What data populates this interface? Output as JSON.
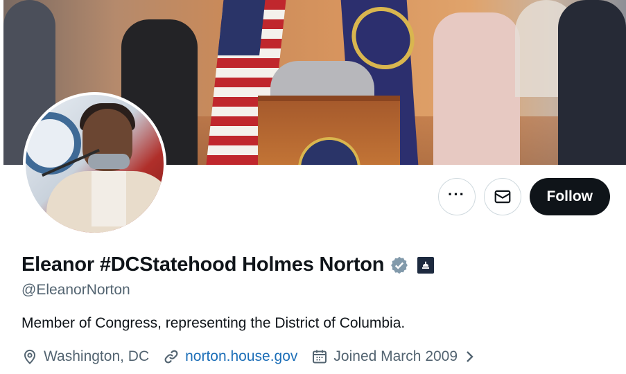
{
  "profile": {
    "name": "Eleanor #DCStatehood Holmes Norton",
    "handle": "@EleanorNorton",
    "bio": "Member of Congress, representing the District of Columbia.",
    "location": "Washington, DC",
    "website": "norton.house.gov",
    "joined": "Joined March 2009",
    "verified_color": "#829aab"
  },
  "actions": {
    "more_icon": "more-horizontal-icon",
    "message_icon": "envelope-icon",
    "follow_label": "Follow"
  },
  "icons": {
    "location": "map-pin-icon",
    "website": "link-icon",
    "joined": "calendar-icon",
    "expand": "chevron-right-icon",
    "verified": "verified-badge-icon",
    "government": "capitol-icon"
  }
}
